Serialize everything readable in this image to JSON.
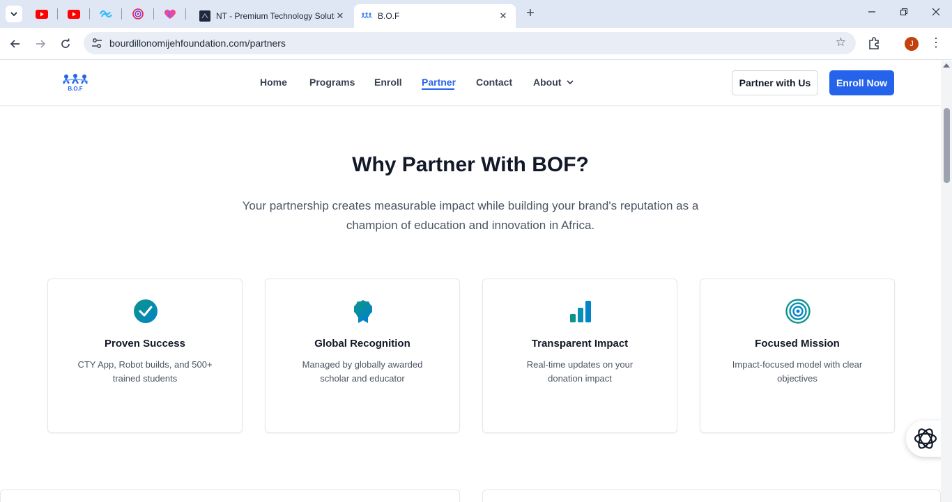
{
  "browser": {
    "tabs": [
      {
        "title": "NT - Premium Technology Soluti",
        "icon": "nt-logo-icon"
      },
      {
        "title": "B.O.F",
        "icon": "bof-logo-icon"
      }
    ],
    "pinned_tabs": [
      "youtube-icon",
      "youtube-icon",
      "tailwind-icon",
      "spiral-icon",
      "heart-app-icon"
    ],
    "url": "bourdillonomijehfoundation.com/partners",
    "profile_initial": "J",
    "new_tab": "+",
    "close": "✕"
  },
  "site": {
    "logo_text": "B.O.F",
    "nav": [
      {
        "label": "Home"
      },
      {
        "label": "Programs"
      },
      {
        "label": "Enroll"
      },
      {
        "label": "Partner",
        "active": true
      },
      {
        "label": "Contact"
      },
      {
        "label": "About"
      }
    ],
    "partner_button": "Partner with Us",
    "enroll_button": "Enroll Now",
    "heading": "Why Partner With BOF?",
    "subtext": "Your partnership creates measurable impact while building your brand's reputation as a champion of education and innovation in Africa.",
    "cards": [
      {
        "title": "Proven Success",
        "description": "CTY App, Robot builds, and 500+ trained students",
        "icon": "check-circle-icon"
      },
      {
        "title": "Global Recognition",
        "description": "Managed by globally awarded scholar and educator",
        "icon": "award-badge-icon"
      },
      {
        "title": "Transparent Impact",
        "description": "Real-time updates on your donation impact",
        "icon": "bar-chart-icon"
      },
      {
        "title": "Focused Mission",
        "description": "Impact-focused model with clear objectives",
        "icon": "target-icon"
      }
    ]
  },
  "colors": {
    "accent": "#2563eb",
    "teal": "#0d9488",
    "tab_strip": "#dfe7f5"
  }
}
